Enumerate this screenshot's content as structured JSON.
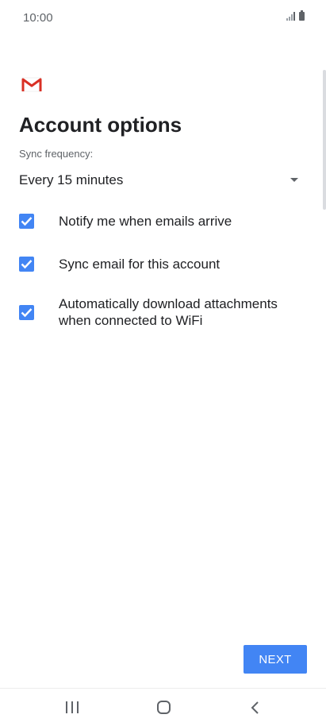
{
  "status_bar": {
    "time": "10:00",
    "icons": [
      "signal-icon",
      "battery-icon"
    ]
  },
  "header": {
    "logo": "gmail-logo-icon",
    "title": "Account options"
  },
  "sync": {
    "label": "Sync frequency:",
    "value": "Every 15 minutes"
  },
  "options": [
    {
      "label": "Notify me when emails arrive",
      "checked": true
    },
    {
      "label": "Sync email for this account",
      "checked": true
    },
    {
      "label": "Automatically download attachments when connected to WiFi",
      "checked": true
    }
  ],
  "actions": {
    "next_label": "NEXT"
  },
  "colors": {
    "accent": "#4285f4",
    "gmail_red": "#d93025",
    "text_primary": "#202124",
    "text_secondary": "#5f6368"
  }
}
